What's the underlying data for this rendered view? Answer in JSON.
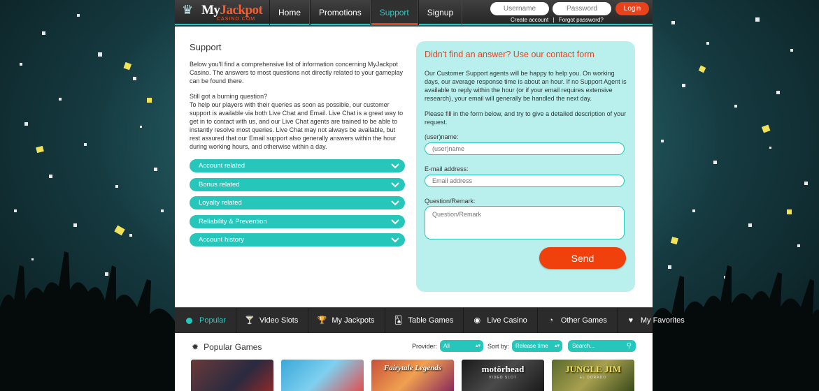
{
  "header": {
    "logo": {
      "brand_left": "My",
      "brand_right": "Jackpot",
      "brand_sub": "CASINO.COM"
    },
    "nav": [
      {
        "label": "Home",
        "active": false
      },
      {
        "label": "Promotions",
        "active": false
      },
      {
        "label": "Support",
        "active": true
      },
      {
        "label": "Signup",
        "active": false
      }
    ],
    "login": {
      "username_placeholder": "Username",
      "password_placeholder": "Password",
      "login_label": "Login",
      "create_account": "Create account",
      "separator": "|",
      "forgot_password": "Forgot password?"
    }
  },
  "support": {
    "title": "Support",
    "intro": "Below you'll find a comprehensive list of information concerning MyJackpot Casino. The answers to most questions not directly related to your gameplay can be found there.",
    "question": "Still got a burning question?\nTo help our players with their queries as soon as possible, our customer support is available via both Live Chat and Email. Live Chat is a great way to get in to contact with us, and our Live Chat agents are trained to be able to instantly resolve most queries. Live Chat may not always be available, but rest assured that our Email support also generally answers within the hour during working hours, and otherwise within a day.",
    "accordion": [
      {
        "label": "Account related"
      },
      {
        "label": "Bonus related"
      },
      {
        "label": "Loyalty related"
      },
      {
        "label": "Reliability & Prevention"
      },
      {
        "label": "Account history"
      }
    ]
  },
  "contact_form": {
    "title": "Didn't find an answer? Use our contact form",
    "para1": "Our Customer Support agents will be happy to help you. On working days, our average response time is about an hour. If no Support Agent is available to reply within the hour (or if your email requires extensive research), your email will generally be handled the next day.",
    "para2": "Please fill in the form below, and try to give a detailed description of your request.",
    "name_label": "(user)name:",
    "name_placeholder": "(user)name",
    "email_label": "E-mail address:",
    "email_placeholder": "Email address",
    "remark_label": "Question/Remark:",
    "remark_placeholder": "Question/Remark",
    "send_label": "Send"
  },
  "game_tabs": [
    {
      "label": "Popular",
      "icon": "dot-icon",
      "active": true
    },
    {
      "label": "Video Slots",
      "icon": "slot-icon",
      "active": false
    },
    {
      "label": "My Jackpots",
      "icon": "trophy-icon",
      "active": false
    },
    {
      "label": "Table Games",
      "icon": "cards-icon",
      "active": false
    },
    {
      "label": "Live Casino",
      "icon": "live-icon",
      "active": false
    },
    {
      "label": "Other Games",
      "icon": "pie-icon",
      "active": false
    },
    {
      "label": "My Favorites",
      "icon": "heart-icon",
      "active": false
    }
  ],
  "popular_games": {
    "title": "Popular Games",
    "provider_label": "Provider:",
    "provider_value": "All",
    "sort_label": "Sort by:",
    "sort_value": "Release time",
    "search_placeholder": "Search...",
    "thumbnails": [
      {
        "title": ""
      },
      {
        "title": ""
      },
      {
        "title": "Fairytale Legends"
      },
      {
        "title": "motörhead",
        "subtitle": "VIDEO SLOT"
      },
      {
        "title": "JUNGLE JIM",
        "subtitle": "EL DORADO"
      }
    ]
  },
  "colors": {
    "accent": "#27c6ba",
    "orange": "#e8421c",
    "form_bg": "#b9f0ed",
    "topbar": "#2e2e2e"
  }
}
